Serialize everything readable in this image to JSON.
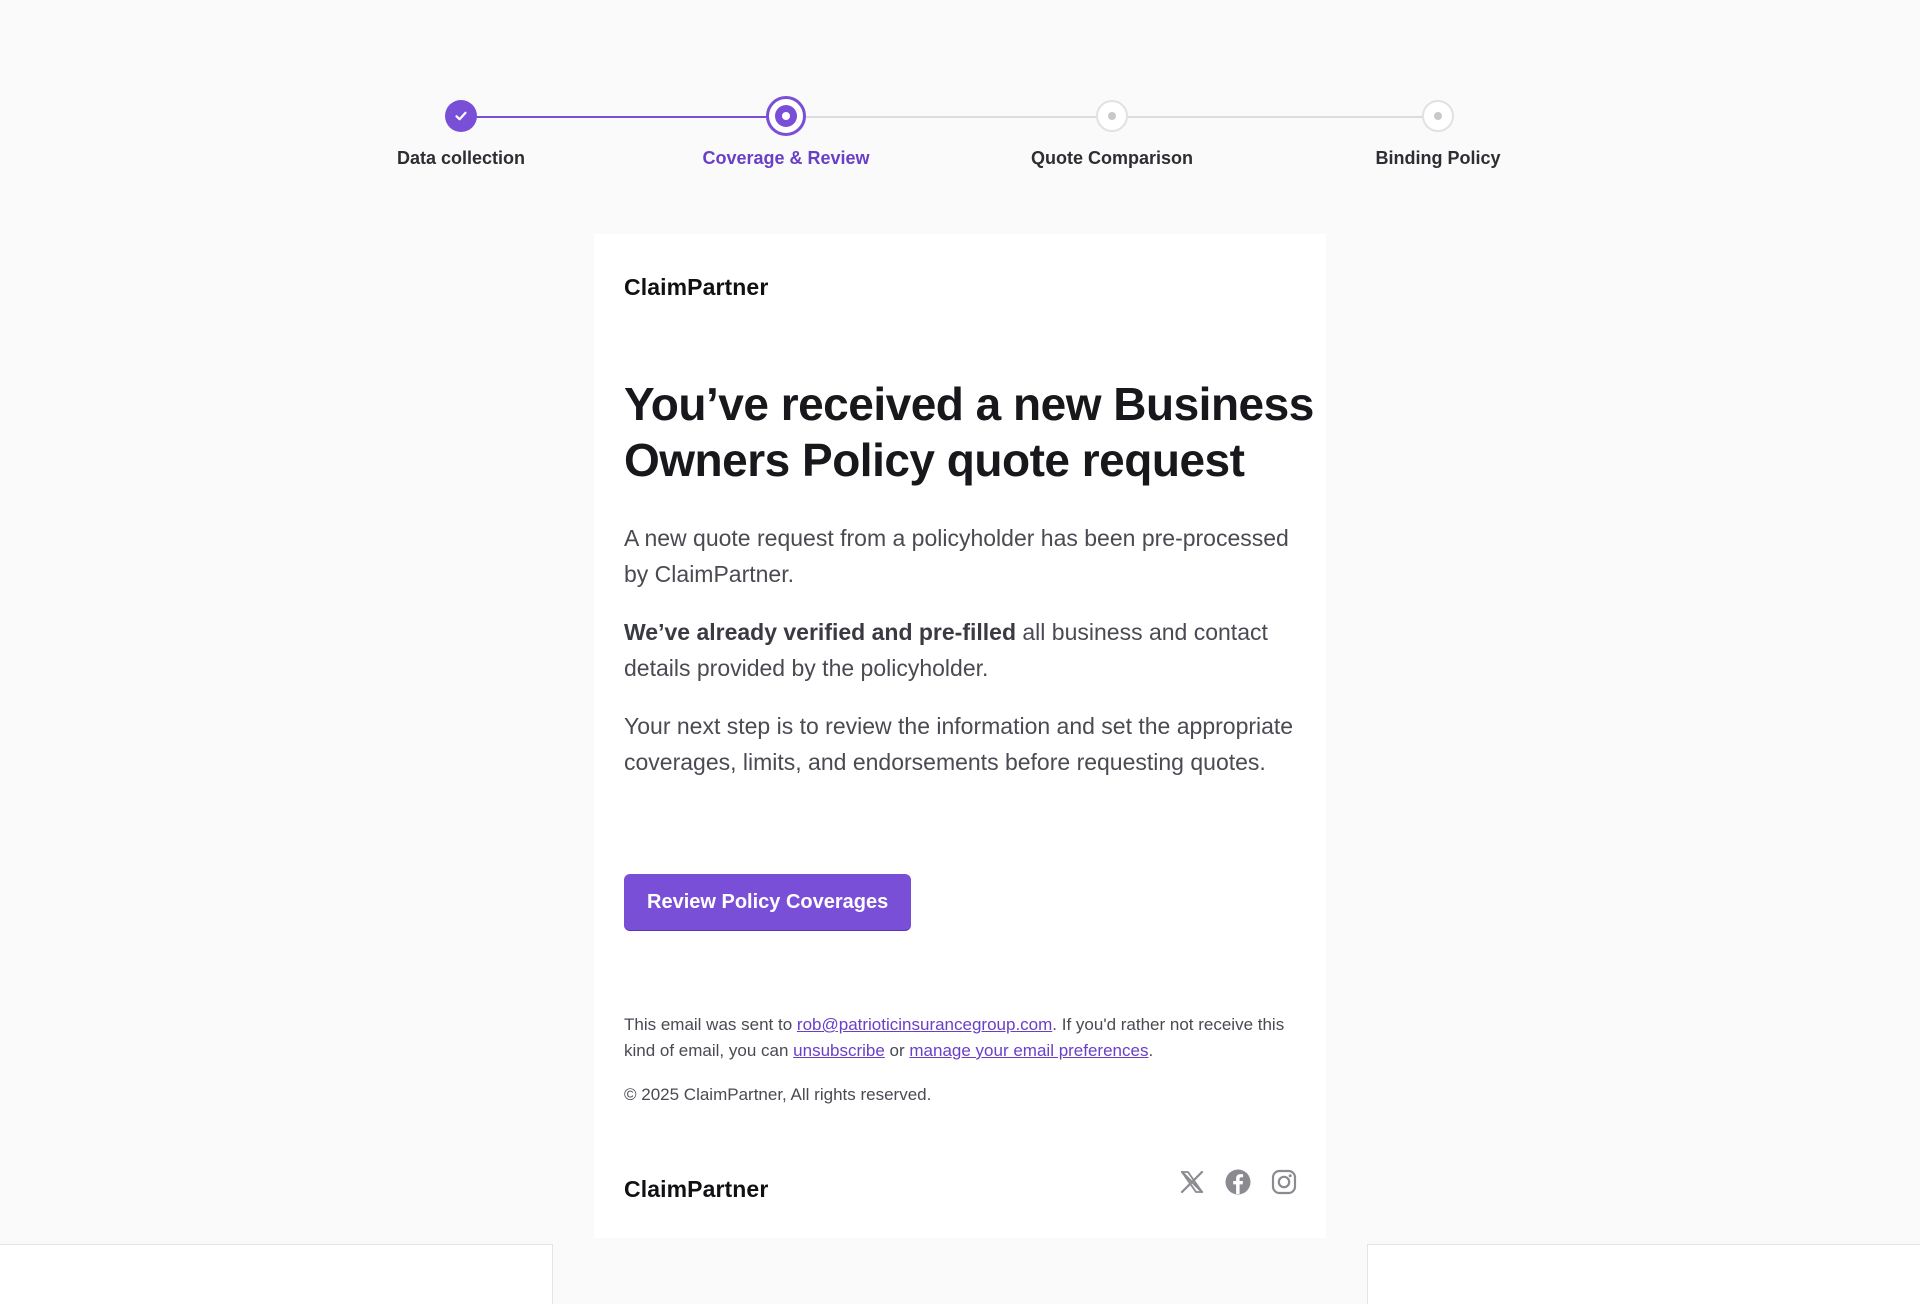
{
  "stepper": {
    "steps": [
      {
        "label": "Data collection",
        "state": "completed"
      },
      {
        "label": "Coverage & Review",
        "state": "current"
      },
      {
        "label": "Quote Comparison",
        "state": "upcoming"
      },
      {
        "label": "Binding Policy",
        "state": "upcoming"
      }
    ]
  },
  "email": {
    "brand": "ClaimPartner",
    "headline": "You’ve received a new Business Owners Policy quote request",
    "paragraph1": "A new quote request from a policyholder has been pre-processed by ClaimPartner.",
    "paragraph2_bold": "We’ve already verified and pre-filled",
    "paragraph2_rest": " all business and contact details provided by the policyholder.",
    "paragraph3": "Your next step is to review the information and set the appropriate coverages, limits, and endorsements before requesting quotes.",
    "cta_label": "Review Policy Coverages",
    "footer": {
      "sent_prefix": "This email was sent to ",
      "email_address": "rob@patrioticinsurancegroup.com",
      "sent_middle": ". If you'd rather not receive this kind of email, you can ",
      "unsubscribe_label": "unsubscribe",
      "or_text": " or ",
      "preferences_label": "manage your email preferences",
      "sent_suffix": ".",
      "copyright": "© 2025 ClaimPartner, All rights reserved."
    },
    "footer_brand": "ClaimPartner",
    "socials": [
      "x-icon",
      "facebook-icon",
      "instagram-icon"
    ]
  },
  "colors": {
    "accent": "#7a4fd8",
    "background": "#fafafa",
    "text": "#17171c",
    "muted": "#4a4a52"
  }
}
